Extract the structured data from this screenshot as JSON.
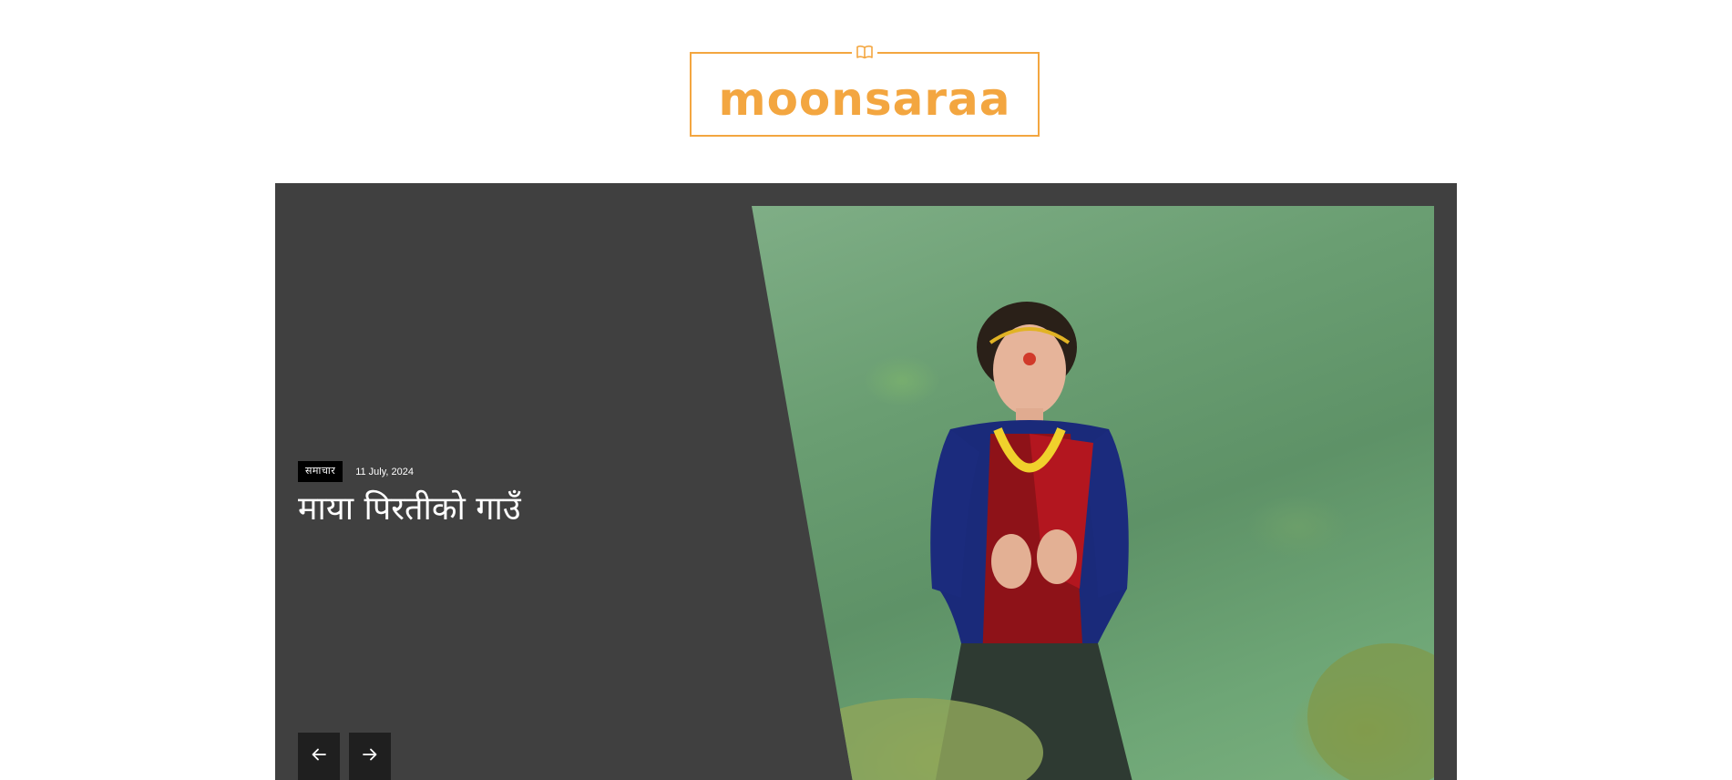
{
  "header": {
    "logo_text": "moonsaraa",
    "logo_icon": "open-book-icon",
    "brand_color": "#f3a640"
  },
  "slider": {
    "background_color": "#404040",
    "slide": {
      "category": "समाचार",
      "date": "11 July, 2024",
      "title": "माया पिरतीको गाउँ"
    },
    "prev_icon": "arrow-left-icon",
    "next_icon": "arrow-right-icon"
  }
}
